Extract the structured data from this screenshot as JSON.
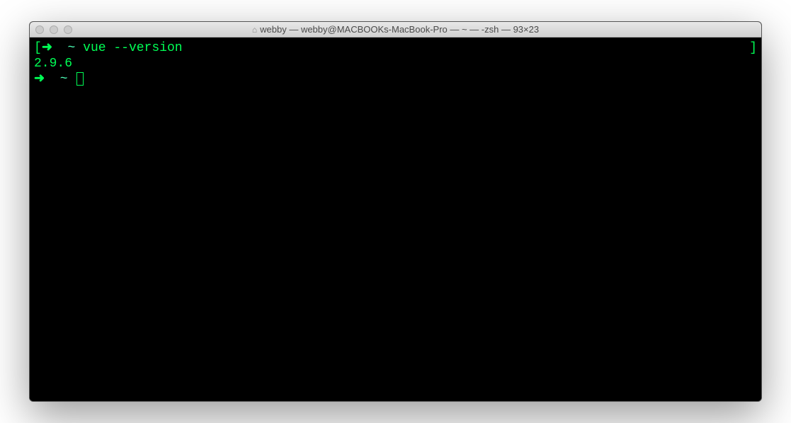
{
  "window": {
    "title": "webby — webby@MACBOOKs-MacBook-Pro — ~ — -zsh — 93×23"
  },
  "terminal": {
    "line1": {
      "left_bracket": "[",
      "arrow": "➜",
      "tilde": "~",
      "command": "vue --version",
      "right_bracket": "]"
    },
    "line2": {
      "output": "2.9.6"
    },
    "line3": {
      "arrow": "➜",
      "tilde": "~"
    }
  }
}
